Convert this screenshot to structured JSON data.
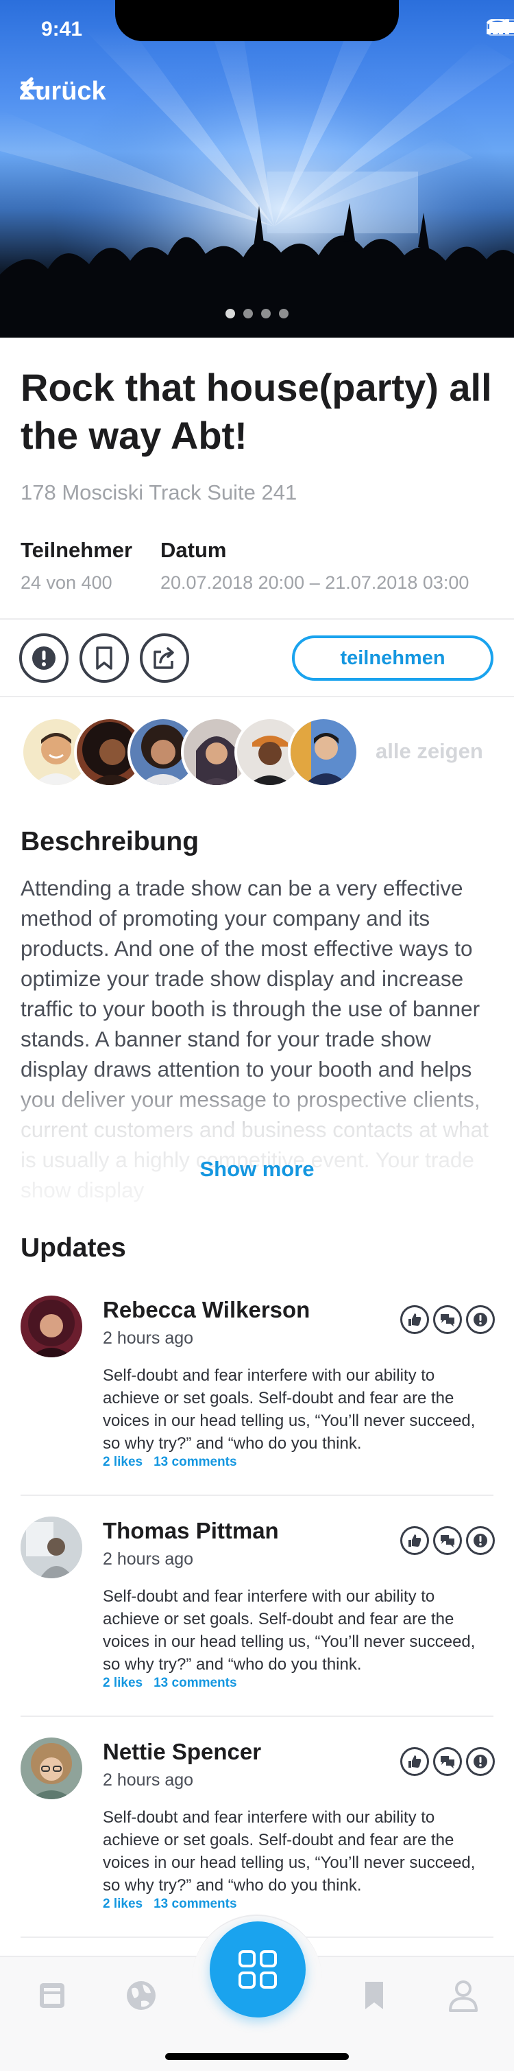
{
  "status_bar": {
    "time": "9:41"
  },
  "hero": {
    "back_label": "Zurück",
    "image": "concert-stage-photo",
    "pagination": {
      "count": 4,
      "active_index": 0
    }
  },
  "event": {
    "title": "Rock that house(party) all the way Abt!",
    "address": "178 Mosciski Track Suite 241",
    "participants_label": "Teilnehmer",
    "participants_value": "24 von 400",
    "date_label": "Datum",
    "date_value": "20.07.2018 20:00 – 21.07.2018 03:00"
  },
  "actions": {
    "report_icon": "exclamation-icon",
    "bookmark_icon": "bookmark-icon",
    "share_icon": "share-icon",
    "join_label": "teilnehmen"
  },
  "attendees": {
    "show_all_label": "alle zeigen",
    "count_shown": 6
  },
  "description": {
    "heading": "Beschreibung",
    "text": "Attending a trade show can be a very effective method of promoting your company and its products. And one of the most effective ways to optimize your trade show display and increase traffic to your booth is through the use of banner stands. A banner stand for your trade show display draws attention to your booth and helps you deliver your message to prospective clients, current customers and business contacts at what is usually a highly competitive event. Your trade show display",
    "show_more_label": "Show more"
  },
  "updates": {
    "heading": "Updates",
    "items": [
      {
        "name": "Rebecca Wilkerson",
        "time": "2 hours ago",
        "text": "Self-doubt and fear interfere with our ability to achieve or set goals. Self-doubt and fear are the voices in our head telling us, “You’ll never succeed, so why try?” and “who do you think.",
        "likes": "2 likes",
        "comments": "13 comments"
      },
      {
        "name": "Thomas Pittman",
        "time": "2 hours ago",
        "text": "Self-doubt and fear interfere with our ability to achieve or set goals. Self-doubt and fear are the voices in our head telling us, “You’ll never succeed, so why try?” and “who do you think.",
        "likes": "2 likes",
        "comments": "13 comments"
      },
      {
        "name": "Nettie Spencer",
        "time": "2 hours ago",
        "text": "Self-doubt and fear interfere with our ability to achieve or set goals. Self-doubt and fear are the voices in our head telling us, “You’ll never succeed, so why try?” and “who do you think.",
        "likes": "2 likes",
        "comments": "13 comments"
      }
    ]
  },
  "tab_bar": {
    "items": [
      "news-icon",
      "globe-icon",
      "grid-icon",
      "bookmark-icon",
      "profile-icon"
    ],
    "active": "grid-icon"
  },
  "colors": {
    "accent": "#1aa3ee",
    "text": "#1d1d1f",
    "muted": "#a0a3a8"
  }
}
